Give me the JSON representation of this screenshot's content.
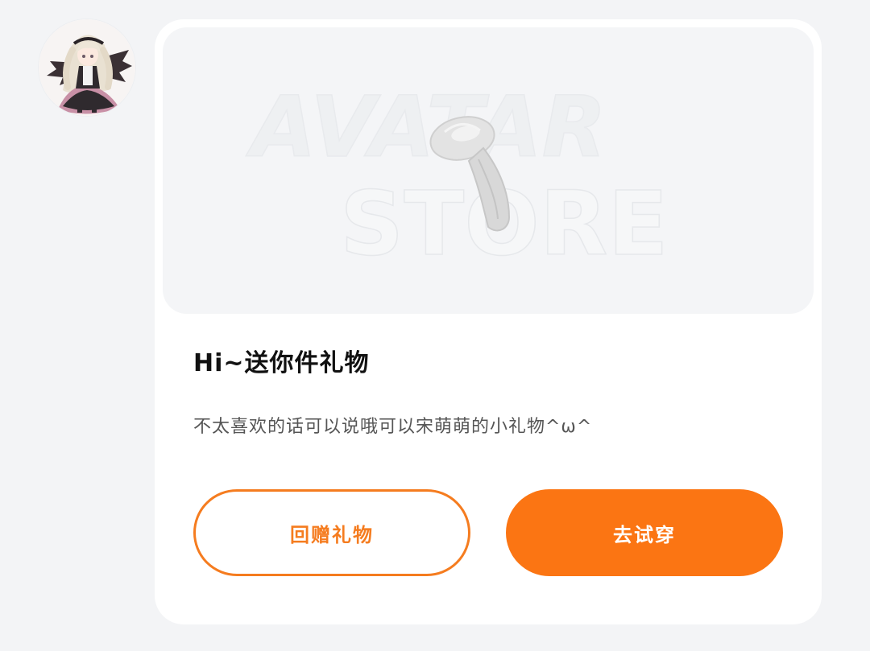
{
  "avatar": {
    "icon": "anime-girl-avatar"
  },
  "gift_card": {
    "banner": {
      "watermark_line1": "AVATAR",
      "watermark_line2": "STORE",
      "item_icon": "fluffy-hair-accessory"
    },
    "title": "Hi~送你件礼物",
    "message": "不太喜欢的话可以说哦可以宋萌萌的小礼物^ω^",
    "buttons": {
      "return_gift": "回赠礼物",
      "try_on": "去试穿"
    }
  },
  "colors": {
    "accent": "#fb7513",
    "background": "#f3f4f6",
    "card": "#ffffff",
    "banner": "#f4f5f7"
  }
}
